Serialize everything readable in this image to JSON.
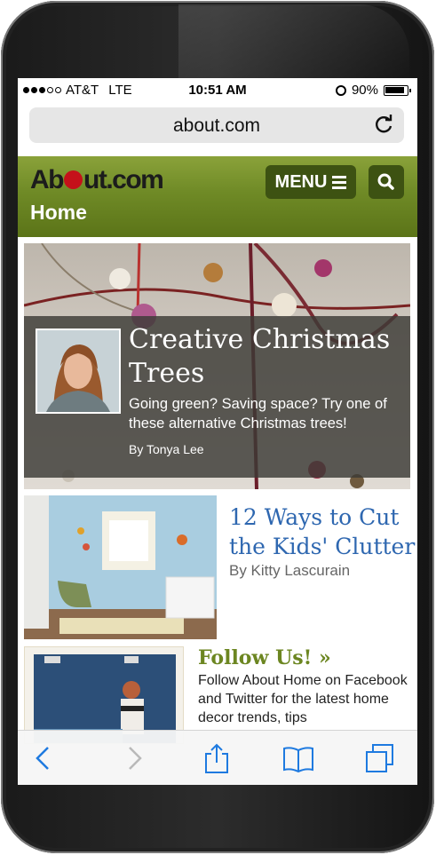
{
  "status_bar": {
    "carrier": "AT&T",
    "network": "LTE",
    "time": "10:51 AM",
    "battery": "90%",
    "battery_level": 0.9
  },
  "browser": {
    "url": "about.com"
  },
  "site": {
    "logo": "About.com",
    "section": "Home",
    "menu_label": "MENU"
  },
  "hero": {
    "title": "Creative Christmas Trees",
    "subtitle": "Going green? Saving space? Try one of these alternative Christmas trees!",
    "byline": "By Tonya Lee"
  },
  "article2": {
    "title": "12 Ways to Cut the Kids' Clutter",
    "byline": "By Kitty Lascurain"
  },
  "follow": {
    "title": "Follow Us! »",
    "text": "Follow About Home on Facebook and Twitter for the latest home decor trends, tips"
  },
  "colors": {
    "header_green": "#6f8a26",
    "button_dark_green": "#3d5212",
    "link_blue": "#2e67b0",
    "ios_blue": "#1e7ae0"
  },
  "icons": [
    "reload-icon",
    "hamburger-icon",
    "search-icon",
    "back-icon",
    "forward-icon",
    "share-icon",
    "bookmarks-icon",
    "tabs-icon"
  ]
}
